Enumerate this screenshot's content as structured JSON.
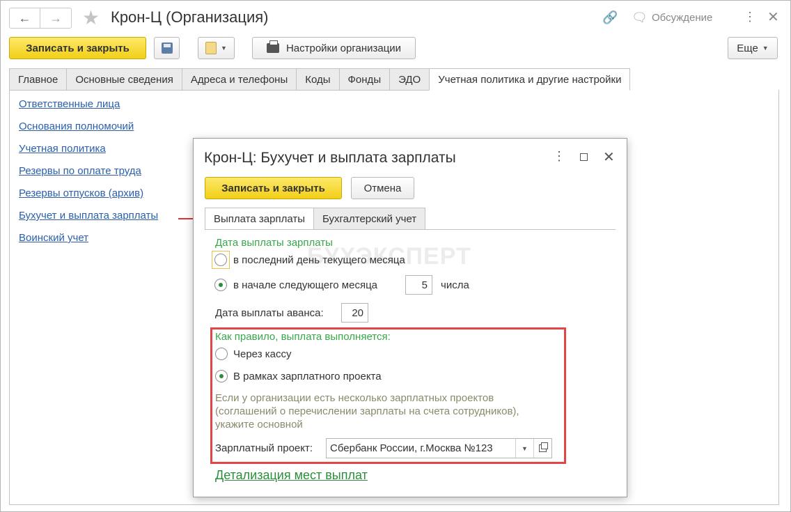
{
  "window": {
    "title": "Крон-Ц (Организация)",
    "discussion_label": "Обсуждение"
  },
  "toolbar": {
    "save_close_label": "Записать и закрыть",
    "settings_label": "Настройки организации",
    "more_label": "Еще"
  },
  "tabs": [
    {
      "label": "Главное"
    },
    {
      "label": "Основные сведения"
    },
    {
      "label": "Адреса и телефоны"
    },
    {
      "label": "Коды"
    },
    {
      "label": "Фонды"
    },
    {
      "label": "ЭДО"
    },
    {
      "label": "Учетная политика и другие настройки"
    }
  ],
  "links": [
    {
      "label": "Ответственные лица"
    },
    {
      "label": "Основания полномочий"
    },
    {
      "label": "Учетная политика"
    },
    {
      "label": "Резервы по оплате труда"
    },
    {
      "label": "Резервы отпусков (архив)"
    },
    {
      "label": "Бухучет и выплата зарплаты"
    },
    {
      "label": "Воинский учет"
    }
  ],
  "dialog": {
    "title": "Крон-Ц: Бухучет и выплата зарплаты",
    "save_close_label": "Записать и закрыть",
    "cancel_label": "Отмена",
    "tabs": [
      {
        "label": "Выплата зарплаты"
      },
      {
        "label": "Бухгалтерский учет"
      }
    ],
    "watermark": "БУХЭКСПЕРТ",
    "pay_date_title": "Дата выплаты зарплаты",
    "option_last_day": "в последний день текущего месяца",
    "option_next_month": "в начале следующего месяца",
    "day_value": "5",
    "day_suffix": "числа",
    "advance_label": "Дата выплаты аванса:",
    "advance_value": "20",
    "payout_title": "Как правило, выплата выполняется:",
    "option_cash": "Через кассу",
    "option_project": "В рамках зарплатного проекта",
    "hint_line1": "Если у организации есть несколько зарплатных проектов",
    "hint_line2": "(соглашений о перечислении зарплаты на счета сотрудников),",
    "hint_line3": "укажите основной",
    "project_label": "Зарплатный проект:",
    "project_value": "Сбербанк России, г.Москва №123",
    "detail_link": "Детализация мест выплат"
  },
  "colors": {
    "primary_button": "#f2cf17",
    "link": "#2b5faa",
    "green_text": "#3aa64a",
    "highlight_border": "#e24545"
  }
}
